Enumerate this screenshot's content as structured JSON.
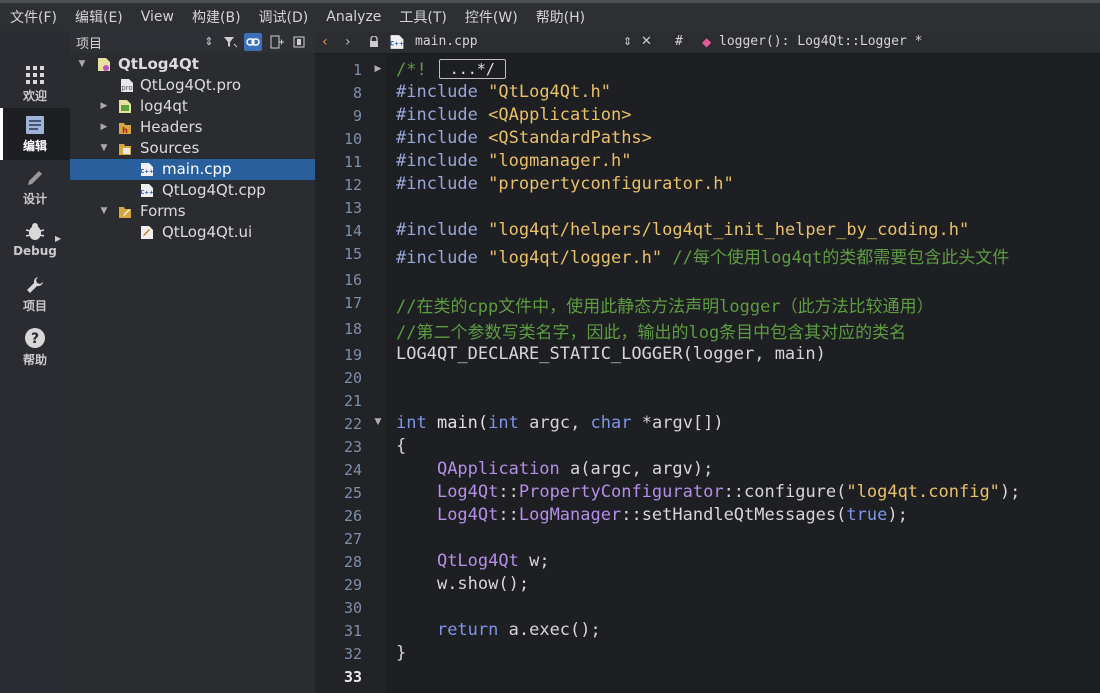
{
  "menubar": {
    "items": [
      "文件(F)",
      "编辑(E)",
      "View",
      "构建(B)",
      "调试(D)",
      "Analyze",
      "工具(T)",
      "控件(W)",
      "帮助(H)"
    ]
  },
  "modes": [
    {
      "label": "欢迎",
      "icon": "grid-icon"
    },
    {
      "label": "编辑",
      "icon": "document-icon",
      "active": true
    },
    {
      "label": "设计",
      "icon": "pencil-icon"
    },
    {
      "label": "Debug",
      "icon": "bug-icon"
    },
    {
      "label": "项目",
      "icon": "wrench-icon"
    },
    {
      "label": "帮助",
      "icon": "help-icon"
    }
  ],
  "project_panel": {
    "title": "项目",
    "tree": [
      {
        "label": "QtLog4Qt",
        "type": "project"
      },
      {
        "label": "QtLog4Qt.pro",
        "type": "pro-file"
      },
      {
        "label": "log4qt",
        "type": "subproject"
      },
      {
        "label": "Headers",
        "type": "folder"
      },
      {
        "label": "Sources",
        "type": "folder"
      },
      {
        "label": "main.cpp",
        "type": "cpp-file",
        "selected": true
      },
      {
        "label": "QtLog4Qt.cpp",
        "type": "cpp-file"
      },
      {
        "label": "Forms",
        "type": "folder"
      },
      {
        "label": "QtLog4Qt.ui",
        "type": "ui-file"
      }
    ]
  },
  "editor": {
    "filename": "main.cpp",
    "hash": "#",
    "symbol": "logger(): Log4Qt::Logger *",
    "line_numbers": [
      "1",
      "8",
      "9",
      "10",
      "11",
      "12",
      "13",
      "14",
      "15",
      "16",
      "17",
      "18",
      "19",
      "20",
      "21",
      "22",
      "23",
      "24",
      "25",
      "26",
      "27",
      "28",
      "29",
      "30",
      "31",
      "32",
      "33"
    ],
    "current_line": "33",
    "code": {
      "l1_comment_start": "/*!",
      "l1_collapsed": "...*/",
      "l8": [
        "#include",
        "\"QtLog4Qt.h\""
      ],
      "l9": [
        "#include",
        "<QApplication>"
      ],
      "l10": [
        "#include",
        "<QStandardPaths>"
      ],
      "l11": [
        "#include",
        "\"logmanager.h\""
      ],
      "l12": [
        "#include",
        "\"propertyconfigurator.h\""
      ],
      "l14": [
        "#include",
        "\"log4qt/helpers/log4qt_init_helper_by_coding.h\""
      ],
      "l15": [
        "#include",
        "\"log4qt/logger.h\"",
        "//每个使用log4qt的类都需要包含此头文件"
      ],
      "l17": "//在类的cpp文件中，使用此静态方法声明logger（此方法比较通用）",
      "l18": "//第二个参数写类名字，因此，输出的log条目中包含其对应的类名",
      "l19": "LOG4QT_DECLARE_STATIC_LOGGER(logger, main)",
      "l22": [
        "int",
        "main(",
        "int",
        "argc, ",
        "char",
        "*argv[])"
      ],
      "l23": "{",
      "l24": [
        "QApplication",
        "a(argc, argv);"
      ],
      "l25": [
        "Log4Qt",
        "::",
        "PropertyConfigurator",
        "::configure(",
        "\"log4qt.config\"",
        ");"
      ],
      "l26": [
        "Log4Qt",
        "::",
        "LogManager",
        "::setHandleQtMessages(",
        "true",
        ");"
      ],
      "l28": [
        "QtLog4Qt",
        "w;"
      ],
      "l29": "w.show();",
      "l31": [
        "return",
        "a.exec();"
      ],
      "l32": "}"
    }
  }
}
